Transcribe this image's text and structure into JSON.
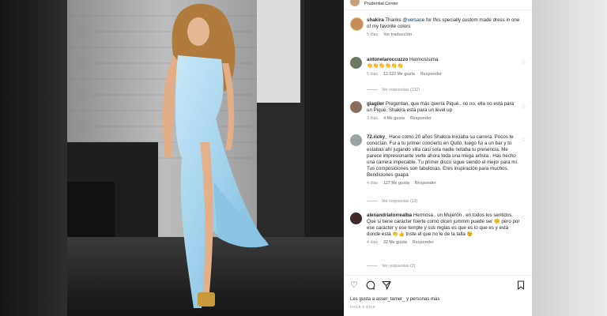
{
  "header": {
    "location": "Prudential Center"
  },
  "caption": {
    "user": "shakira",
    "text_before": "Thanks ",
    "mention": "@versace",
    "text_after": " for this specially custom made dress in one of my favorite colors",
    "time": "5 días",
    "translate": "Ver traducción"
  },
  "comments": [
    {
      "user": "antonelaroccuzzo",
      "text": "Hermosísima",
      "emojis": "👏👏👏👏👏👏",
      "time": "5 días",
      "likes": "12.523 Me gusta",
      "reply": "Responder",
      "view_replies": "Ver respuestas (132)"
    },
    {
      "user": "giagiler",
      "text": "Preguntan, que más quería Piqué.. no no, ella no está para un Pique. Shakira está para un level up",
      "time": "3 días",
      "likes": "4 Me gusta",
      "reply": "Responder"
    },
    {
      "user": "72.ricky_",
      "text": "Hace como 20 años Shakira iniciaba su carrera. Pocos te conocían. Fui a tu primer concierto en Quito, luego fui a un bar y tú estabas ahí jugando villa casi sola nadie notaba tu presencia. Me parece impresionante verte ahora toda una mega artista . Has hecho una carrera impecable. Tu primer disco sigue siendo el mejor para mí. Tus composiciones son fabulosas. Eres inspiración para muchos. Bendiciones guapa",
      "time": "4 días",
      "likes": "127 Me gusta",
      "reply": "Responder",
      "view_replies": "Ver respuestas (13)"
    },
    {
      "user": "alexandriatorrealba",
      "text": "Hermosa . un Mujerón . en todos los sentidos. Que si tiene carácter fuerte como dicen jummm puede ser 😕 pero por ese carácter y ese temple y sus reglas es que es lo que es y está donde está 👏👍 triste el que no le de la talla 😉",
      "time": "4 días",
      "likes": "22 Me gusta",
      "reply": "Responder",
      "view_replies": "Ver respuestas (2)"
    }
  ],
  "footer": {
    "likes": "Les gusta a asser_tamer_ y personas más",
    "ago": "HACE 5 DÍAS"
  },
  "icons": {
    "heart": "heart-icon",
    "comment": "comment-icon",
    "share": "share-icon",
    "save": "bookmark-icon",
    "next": "chevron-right-icon"
  },
  "colors": {
    "dress": "#9fd2ec",
    "link": "#00376b",
    "meta": "#8e8e8e"
  }
}
